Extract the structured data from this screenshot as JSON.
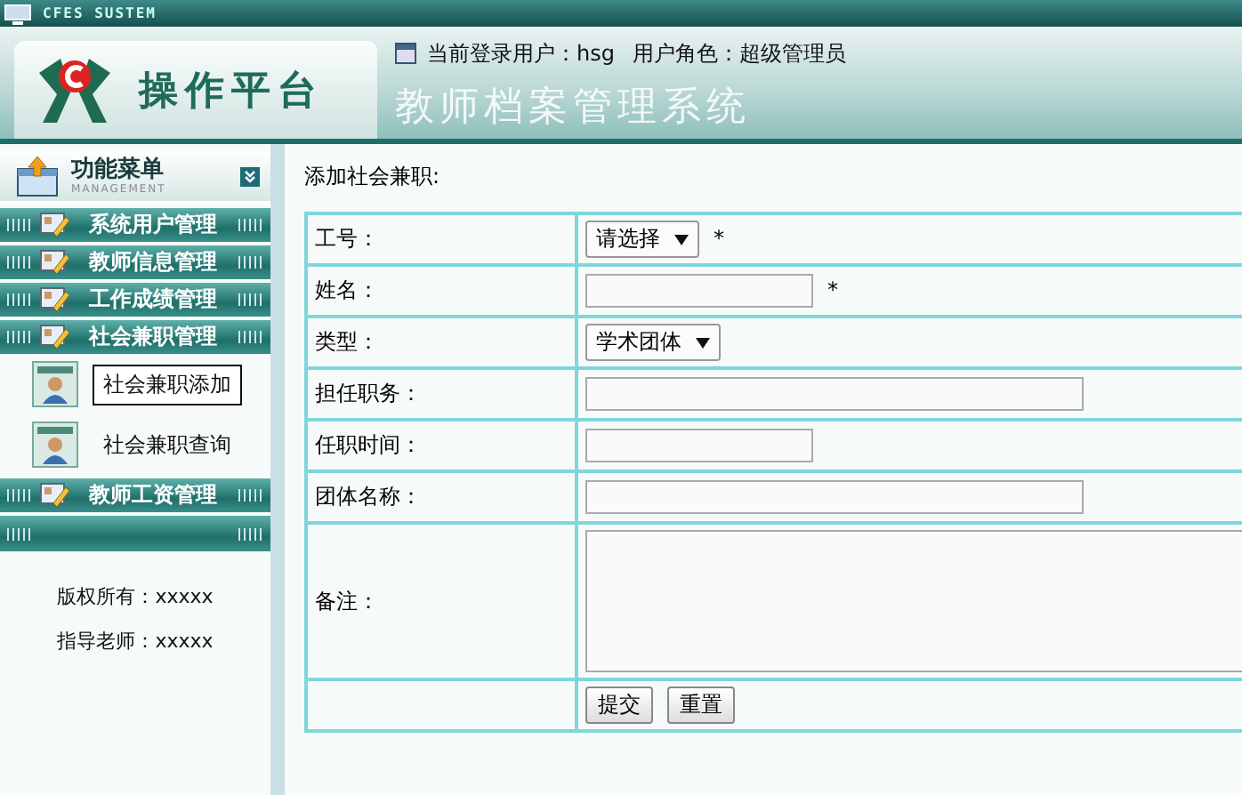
{
  "top_bar": {
    "label": "CFES SUSTEM"
  },
  "header": {
    "logo_text": "操作平台",
    "user": "当前登录用户：hsg",
    "role": "用户角色：超级管理员",
    "title": "教师档案管理系统"
  },
  "sidebar": {
    "menu_title": "功能菜单",
    "menu_subtitle": "MANAGEMENT",
    "groups": [
      {
        "label": "系统用户管理"
      },
      {
        "label": "教师信息管理"
      },
      {
        "label": "工作成绩管理"
      },
      {
        "label": "社会兼职管理",
        "children": [
          {
            "label": "社会兼职添加",
            "selected": true
          },
          {
            "label": "社会兼职查询",
            "selected": false
          }
        ]
      },
      {
        "label": "教师工资管理"
      }
    ],
    "footer": [
      "版权所有：xxxxx",
      "指导老师：xxxxx"
    ]
  },
  "form": {
    "heading": "添加社会兼职:",
    "rows": [
      {
        "kind": "select",
        "label": "工号：",
        "value": "请选择",
        "required": true
      },
      {
        "kind": "input",
        "label": "姓名：",
        "required": true
      },
      {
        "kind": "select",
        "label": "类型：",
        "value": "学术团体",
        "required": false
      },
      {
        "kind": "long",
        "label": "担任职务：",
        "required": false
      },
      {
        "kind": "input",
        "label": "任职时间：",
        "required": false
      },
      {
        "kind": "long",
        "label": "团体名称：",
        "required": false
      },
      {
        "kind": "textarea",
        "label": "备注：",
        "required": false
      }
    ],
    "required_mark": "*",
    "buttons": [
      "提交",
      "重置"
    ]
  }
}
